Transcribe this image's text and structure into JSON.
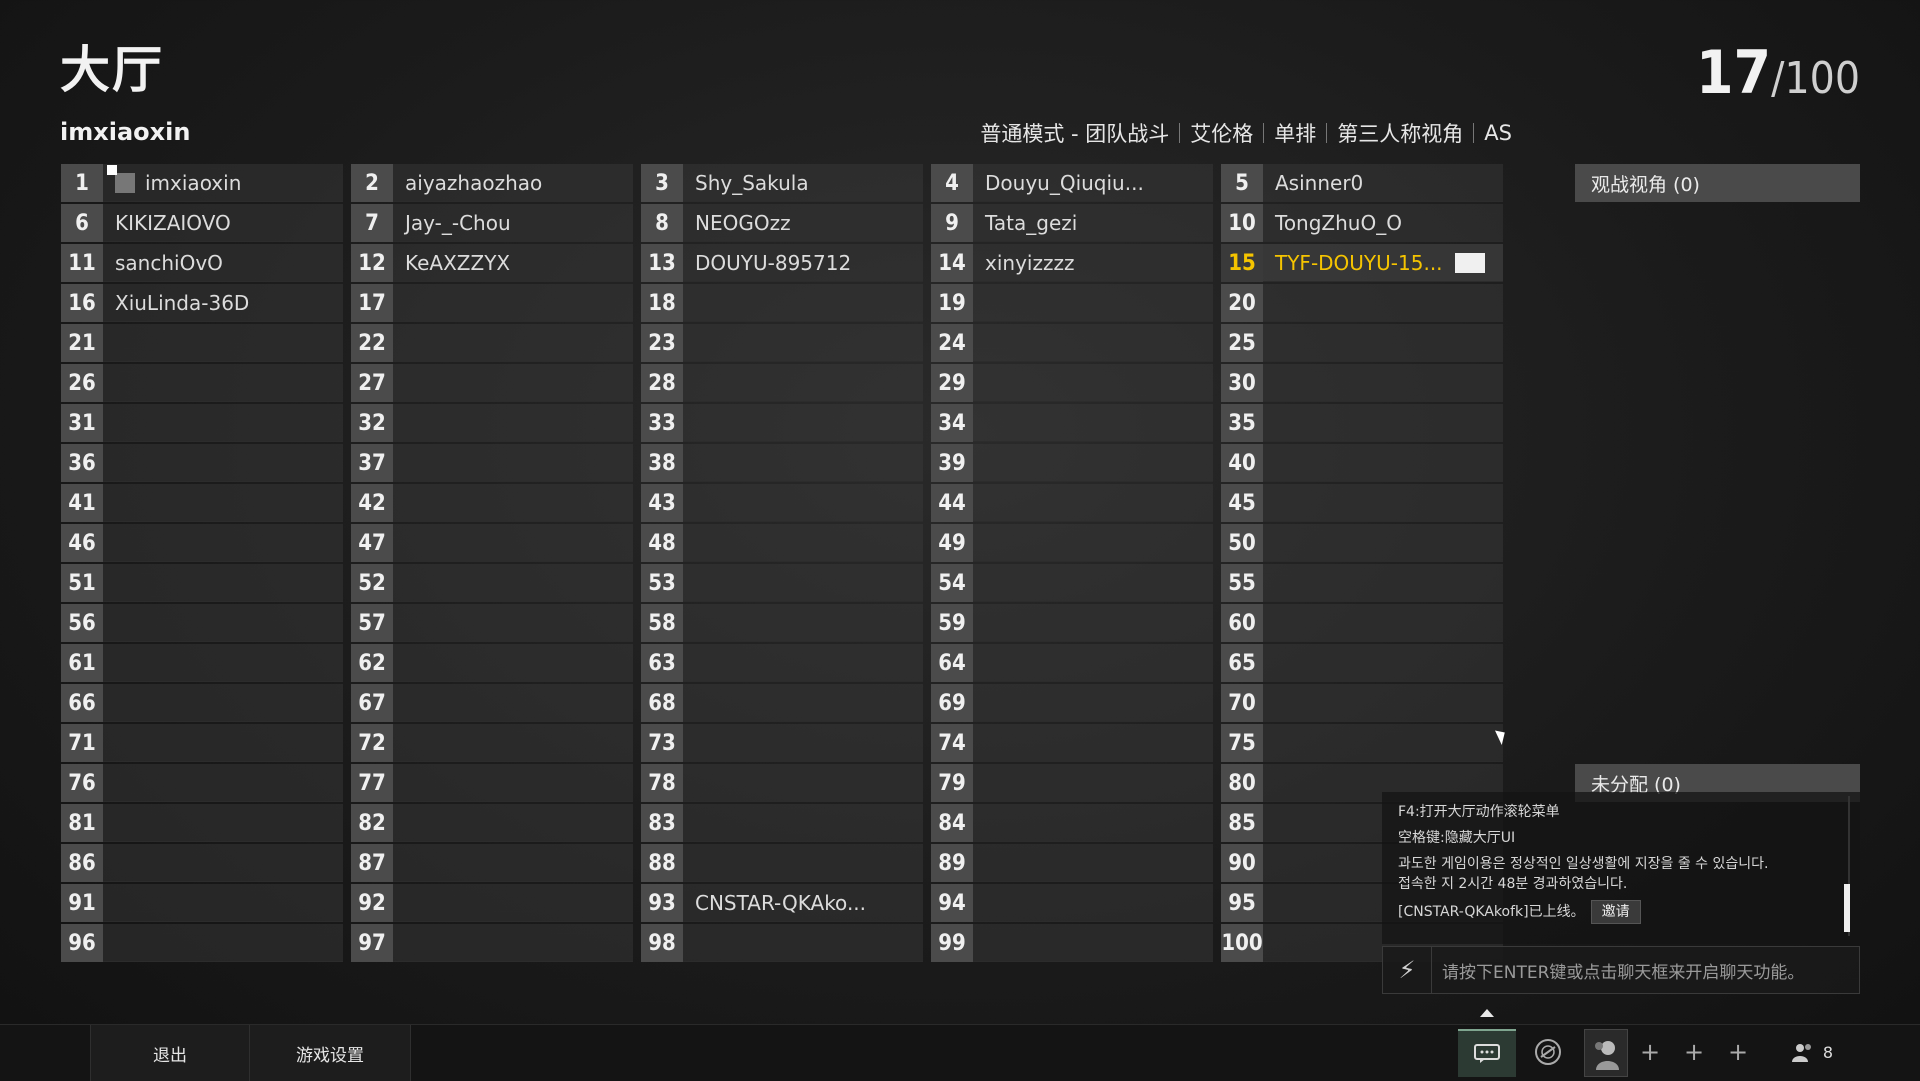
{
  "header": {
    "title": "大厅",
    "count_current": "17",
    "count_sep": "/",
    "count_total": "100",
    "player_name": "imxiaoxin"
  },
  "mode": [
    "普通模式 - 团队战斗",
    "艾伦格",
    "单排",
    "第三人称视角",
    "AS"
  ],
  "slots": [
    {
      "n": "1",
      "name": "imxiaoxin",
      "host": true
    },
    {
      "n": "2",
      "name": "aiyazhaozhao"
    },
    {
      "n": "3",
      "name": "Shy_Sakula"
    },
    {
      "n": "4",
      "name": "Douyu_Qiuqiu..."
    },
    {
      "n": "5",
      "name": "Asinner0"
    },
    {
      "n": "6",
      "name": "KIKIZAIOVO"
    },
    {
      "n": "7",
      "name": "Jay-_-Chou"
    },
    {
      "n": "8",
      "name": "NEOGOzz"
    },
    {
      "n": "9",
      "name": "Tata_gezi"
    },
    {
      "n": "10",
      "name": "TongZhuO_O"
    },
    {
      "n": "11",
      "name": "sanchiOvO"
    },
    {
      "n": "12",
      "name": "KeAXZZYX"
    },
    {
      "n": "13",
      "name": "DOUYU-895712"
    },
    {
      "n": "14",
      "name": "xinyizzzz"
    },
    {
      "n": "15",
      "name": "TYF-DOUYU-15...",
      "highlight": true,
      "ready": true
    },
    {
      "n": "16",
      "name": "XiuLinda-36D"
    },
    {
      "n": "17",
      "name": ""
    },
    {
      "n": "18",
      "name": ""
    },
    {
      "n": "19",
      "name": ""
    },
    {
      "n": "20",
      "name": ""
    },
    {
      "n": "21",
      "name": ""
    },
    {
      "n": "22",
      "name": ""
    },
    {
      "n": "23",
      "name": ""
    },
    {
      "n": "24",
      "name": ""
    },
    {
      "n": "25",
      "name": ""
    },
    {
      "n": "26",
      "name": ""
    },
    {
      "n": "27",
      "name": ""
    },
    {
      "n": "28",
      "name": ""
    },
    {
      "n": "29",
      "name": ""
    },
    {
      "n": "30",
      "name": ""
    },
    {
      "n": "31",
      "name": ""
    },
    {
      "n": "32",
      "name": ""
    },
    {
      "n": "33",
      "name": ""
    },
    {
      "n": "34",
      "name": ""
    },
    {
      "n": "35",
      "name": ""
    },
    {
      "n": "36",
      "name": ""
    },
    {
      "n": "37",
      "name": ""
    },
    {
      "n": "38",
      "name": ""
    },
    {
      "n": "39",
      "name": ""
    },
    {
      "n": "40",
      "name": ""
    },
    {
      "n": "41",
      "name": ""
    },
    {
      "n": "42",
      "name": ""
    },
    {
      "n": "43",
      "name": ""
    },
    {
      "n": "44",
      "name": ""
    },
    {
      "n": "45",
      "name": ""
    },
    {
      "n": "46",
      "name": ""
    },
    {
      "n": "47",
      "name": ""
    },
    {
      "n": "48",
      "name": ""
    },
    {
      "n": "49",
      "name": ""
    },
    {
      "n": "50",
      "name": ""
    },
    {
      "n": "51",
      "name": ""
    },
    {
      "n": "52",
      "name": ""
    },
    {
      "n": "53",
      "name": ""
    },
    {
      "n": "54",
      "name": ""
    },
    {
      "n": "55",
      "name": ""
    },
    {
      "n": "56",
      "name": ""
    },
    {
      "n": "57",
      "name": ""
    },
    {
      "n": "58",
      "name": ""
    },
    {
      "n": "59",
      "name": ""
    },
    {
      "n": "60",
      "name": ""
    },
    {
      "n": "61",
      "name": ""
    },
    {
      "n": "62",
      "name": ""
    },
    {
      "n": "63",
      "name": ""
    },
    {
      "n": "64",
      "name": ""
    },
    {
      "n": "65",
      "name": ""
    },
    {
      "n": "66",
      "name": ""
    },
    {
      "n": "67",
      "name": ""
    },
    {
      "n": "68",
      "name": ""
    },
    {
      "n": "69",
      "name": ""
    },
    {
      "n": "70",
      "name": ""
    },
    {
      "n": "71",
      "name": ""
    },
    {
      "n": "72",
      "name": ""
    },
    {
      "n": "73",
      "name": ""
    },
    {
      "n": "74",
      "name": ""
    },
    {
      "n": "75",
      "name": ""
    },
    {
      "n": "76",
      "name": ""
    },
    {
      "n": "77",
      "name": ""
    },
    {
      "n": "78",
      "name": ""
    },
    {
      "n": "79",
      "name": ""
    },
    {
      "n": "80",
      "name": ""
    },
    {
      "n": "81",
      "name": ""
    },
    {
      "n": "82",
      "name": ""
    },
    {
      "n": "83",
      "name": ""
    },
    {
      "n": "84",
      "name": ""
    },
    {
      "n": "85",
      "name": ""
    },
    {
      "n": "86",
      "name": ""
    },
    {
      "n": "87",
      "name": ""
    },
    {
      "n": "88",
      "name": ""
    },
    {
      "n": "89",
      "name": ""
    },
    {
      "n": "90",
      "name": ""
    },
    {
      "n": "91",
      "name": ""
    },
    {
      "n": "92",
      "name": ""
    },
    {
      "n": "93",
      "name": "CNSTAR-QKAko..."
    },
    {
      "n": "94",
      "name": ""
    },
    {
      "n": "95",
      "name": ""
    },
    {
      "n": "96",
      "name": ""
    },
    {
      "n": "97",
      "name": ""
    },
    {
      "n": "98",
      "name": ""
    },
    {
      "n": "99",
      "name": ""
    },
    {
      "n": "100",
      "name": ""
    }
  ],
  "side": {
    "spectator": "观战视角 (0)",
    "unassigned": "未分配 (0)"
  },
  "chat": {
    "lines": [
      "F4:打开大厅动作滚轮菜单",
      "空格键:隐藏大厅UI",
      "과도한 게임이용은 정상적인 일상생활에 지장을 줄 수 있습니다.",
      "접속한 지 2시간 48분 경과하였습니다."
    ],
    "online_msg": "[CNSTAR-QKAkofk]已上线。",
    "invite": "邀请",
    "placeholder": "请按下ENTER键或点击聊天框来开启聊天功能。"
  },
  "bottom": {
    "exit": "退出",
    "settings": "游戏设置",
    "friends_count": "8"
  },
  "colors": {
    "highlight": "#f5c400"
  }
}
